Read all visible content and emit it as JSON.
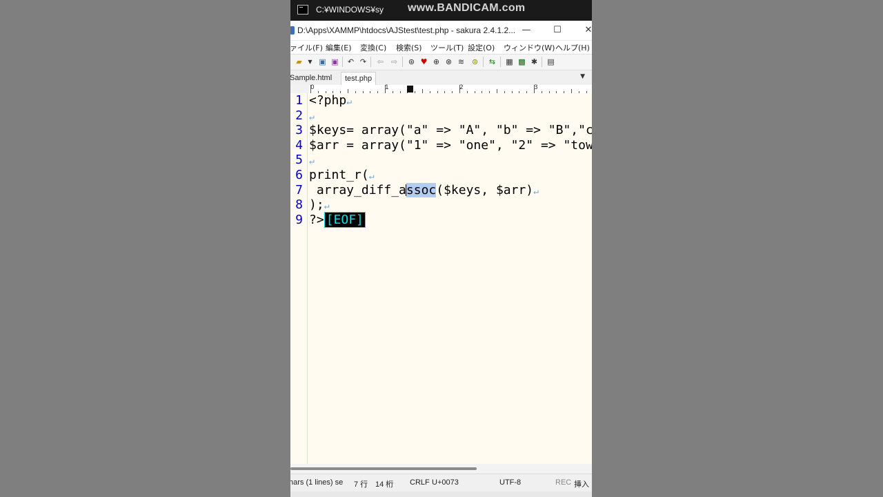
{
  "console": {
    "title": "C:¥WINDOWS¥sy",
    "watermark": "www.BANDICAM.com"
  },
  "window": {
    "title": "D:\\Apps\\XAMMP\\htdocs\\AJStest\\test.php - sakura 2.4.1.2...",
    "minimize": "—",
    "maximize": "☐",
    "close": "✕"
  },
  "menu": {
    "items": [
      "ァイル(F)",
      "編集(E)",
      "変換(C)",
      "検索(S)",
      "ツール(T)",
      "設定(O)",
      "ウィンドウ(W)",
      "ヘルプ(H)"
    ]
  },
  "toolbar": {
    "icons": [
      "open-folder-icon",
      "dropdown-arrow-icon",
      "save-icon",
      "save-all-icon",
      "undo-icon",
      "redo-icon",
      "back-icon",
      "forward-icon",
      "search-icon",
      "search-prev-icon",
      "search-next-icon",
      "replace-icon",
      "grep-icon",
      "jump-icon",
      "compare-icon",
      "outline-icon",
      "macro-icon",
      "settings-icon",
      "font-icon"
    ]
  },
  "tabs": {
    "items": [
      "Sample.html",
      "test.php"
    ],
    "active": "test.php"
  },
  "ruler": {
    "labels": [
      "0",
      "1",
      "2",
      "3"
    ]
  },
  "editor": {
    "line_numbers": [
      "1",
      "2",
      "3",
      "4",
      "5",
      "6",
      "7",
      "8",
      "9"
    ],
    "eol_symbol": "↵",
    "eof_marker": "[EOF]",
    "lines": {
      "l1": "<?php",
      "l3": "$keys= array(\"a\" => \"A\", \"b\" => \"B\",\"c",
      "l4": "$arr = array(\"1\" => \"one\", \"2\" => \"tow",
      "l6": "print_r(",
      "l7_before": " array_diff_a",
      "l7_selected": "ssoc",
      "l7_after": "($keys, $arr)",
      "l8": ");",
      "l9": "?>"
    }
  },
  "status": {
    "selection": "hars (1 lines) se",
    "line": "7 行",
    "column": "14 桁",
    "newline": "CRLF",
    "codepoint": "U+0073",
    "encoding": "UTF-8",
    "rec": "REC",
    "insert_mode": "挿入"
  }
}
